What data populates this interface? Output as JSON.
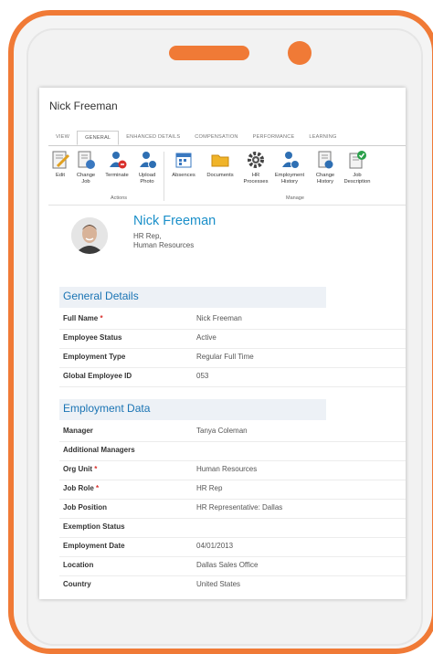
{
  "window": {
    "title": "Nick Freeman"
  },
  "tabs": [
    {
      "label": "VIEW"
    },
    {
      "label": "GENERAL"
    },
    {
      "label": "ENHANCED DETAILS"
    },
    {
      "label": "COMPENSATION"
    },
    {
      "label": "PERFORMANCE"
    },
    {
      "label": "LEARNING"
    }
  ],
  "ribbon": {
    "actions_group": "Actions",
    "manage_group": "Manage",
    "buttons": [
      {
        "label": "Edit",
        "icon": "edit-icon"
      },
      {
        "label": "Change Job",
        "icon": "change-job-icon"
      },
      {
        "label": "Terminate",
        "icon": "terminate-icon"
      },
      {
        "label": "Upload Photo",
        "icon": "upload-photo-icon"
      },
      {
        "label": "Absences",
        "icon": "calendar-icon"
      },
      {
        "label": "Documents",
        "icon": "folder-icon"
      },
      {
        "label": "HR Processes",
        "icon": "gear-icon"
      },
      {
        "label": "Employment History",
        "icon": "employment-history-icon"
      },
      {
        "label": "Change History",
        "icon": "change-history-icon"
      },
      {
        "label": "Job Description",
        "icon": "job-description-icon"
      }
    ]
  },
  "employee": {
    "name": "Nick Freeman",
    "role": "HR Rep,",
    "department": "Human Resources"
  },
  "general_details": {
    "title": "General Details",
    "rows": [
      {
        "label": "Full Name",
        "required": "*",
        "value": "Nick Freeman"
      },
      {
        "label": "Employee Status",
        "required": "",
        "value": "Active"
      },
      {
        "label": "Employment Type",
        "required": "",
        "value": "Regular Full Time"
      },
      {
        "label": "Global Employee ID",
        "required": "",
        "value": "053"
      }
    ]
  },
  "employment_data": {
    "title": "Employment Data",
    "rows": [
      {
        "label": "Manager",
        "required": "",
        "value": "Tanya Coleman"
      },
      {
        "label": "Additional Managers",
        "required": "",
        "value": ""
      },
      {
        "label": "Org Unit",
        "required": "*",
        "value": "Human Resources"
      },
      {
        "label": "Job Role",
        "required": "*",
        "value": "HR Rep"
      },
      {
        "label": "Job Position",
        "required": "",
        "value": "HR Representative: Dallas"
      },
      {
        "label": "Exemption Status",
        "required": "",
        "value": ""
      },
      {
        "label": "Employment Date",
        "required": "",
        "value": "04/01/2013"
      },
      {
        "label": "Location",
        "required": "",
        "value": "Dallas Sales Office"
      },
      {
        "label": "Country",
        "required": "",
        "value": "United States"
      }
    ]
  },
  "colors": {
    "frame": "#f07a36",
    "accent": "#1a8fc9",
    "section_title": "#1a74b4"
  }
}
